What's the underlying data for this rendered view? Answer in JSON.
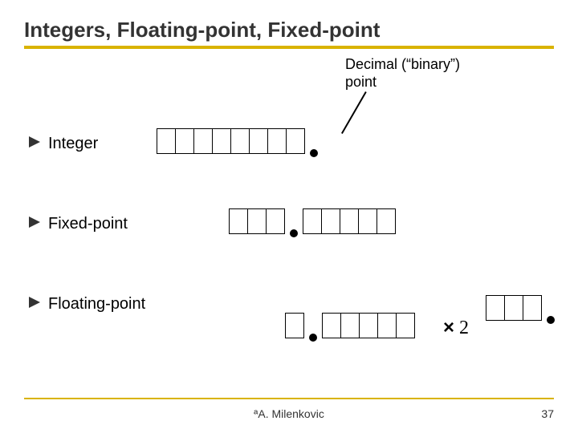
{
  "title": "Integers, Floating-point, Fixed-point",
  "caption_line1": "Decimal (“binary”)",
  "caption_line2": "point",
  "bullets": {
    "integer": "Integer",
    "fixed": "Fixed-point",
    "float": "Floating-point"
  },
  "symbols": {
    "times": "×",
    "two": "2"
  },
  "footer": {
    "copyright": "ªA. Milenkovic",
    "page": "37"
  }
}
